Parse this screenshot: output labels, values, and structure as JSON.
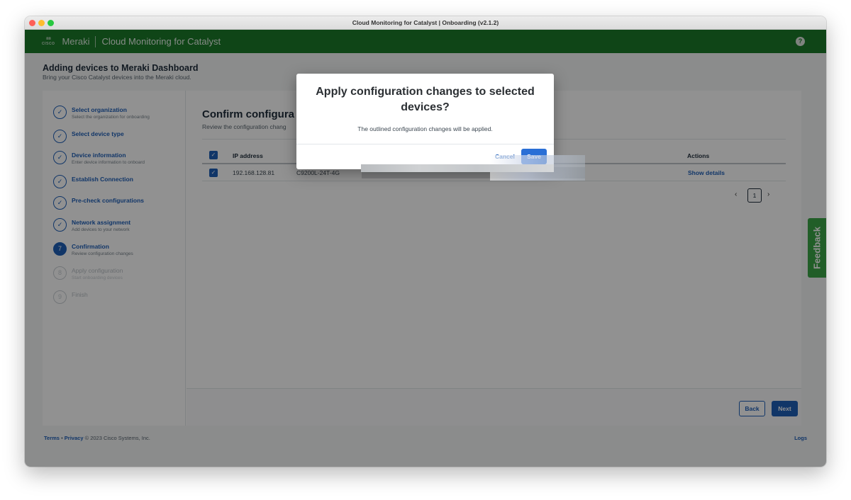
{
  "window": {
    "title": "Cloud Monitoring for Catalyst | Onboarding (v2.1.2)"
  },
  "appbar": {
    "cisco_word": "cisco",
    "brand": "Meraki",
    "product": "Cloud Monitoring for Catalyst",
    "help_glyph": "?"
  },
  "page": {
    "title": "Adding devices to Meraki Dashboard",
    "subtitle": "Bring your Cisco Catalyst devices into the Meraki cloud."
  },
  "steps": [
    {
      "title": "Select organization",
      "desc": "Select the organization for onboarding",
      "state": "done"
    },
    {
      "title": "Select device type",
      "desc": "",
      "state": "done"
    },
    {
      "title": "Device information",
      "desc": "Enter device information to onboard",
      "state": "done"
    },
    {
      "title": "Establish Connection",
      "desc": "",
      "state": "done"
    },
    {
      "title": "Pre-check configurations",
      "desc": "",
      "state": "done"
    },
    {
      "title": "Network assignment",
      "desc": "Add devices to your network",
      "state": "done"
    },
    {
      "title": "Confirmation",
      "desc": "Review configuration changes",
      "state": "current",
      "number": "7"
    },
    {
      "title": "Apply configuration",
      "desc": "Start onboarding devices",
      "state": "future",
      "number": "8"
    },
    {
      "title": "Finish",
      "desc": "",
      "state": "future",
      "number": "9"
    }
  ],
  "content": {
    "title": "Confirm configura",
    "desc": "Review the configuration chang",
    "table": {
      "headers": {
        "ip": "IP address",
        "actions": "Actions"
      },
      "rows": [
        {
          "ip": "192.168.128.81",
          "model": "C9200L-24T-4G",
          "action": "Show details"
        }
      ]
    },
    "pagination": {
      "prev": "‹",
      "page": "1",
      "next": "›"
    },
    "buttons": {
      "back": "Back",
      "next": "Next"
    }
  },
  "footer": {
    "terms": "Terms",
    "bullet": "•",
    "privacy": "Privacy",
    "copyright": "© 2023 Cisco Systems, Inc.",
    "logs": "Logs"
  },
  "feedback": {
    "label": "Feedback"
  },
  "modal": {
    "title": "Apply configuration changes to selected devices?",
    "body": "The outlined configuration changes will be applied.",
    "cancel": "Cancel",
    "save": "Save"
  },
  "colors": {
    "appbar": "#1c7a2a",
    "accent": "#1f5fb8",
    "feedback": "#3aa547"
  }
}
